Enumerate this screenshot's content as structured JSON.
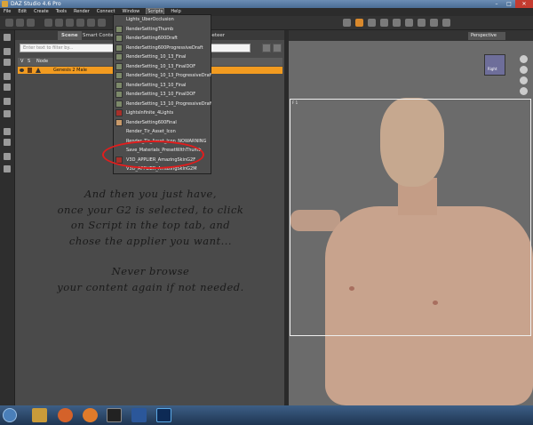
{
  "window": {
    "title": "DAZ Studio 4.6 Pro"
  },
  "menubar": [
    "File",
    "Edit",
    "Create",
    "Tools",
    "Render",
    "Connect",
    "Window",
    "Scripts",
    "Help"
  ],
  "active_menu": "Scripts",
  "panel": {
    "tabs": [
      "Scene",
      "Smart Content",
      "Poppeteer"
    ],
    "filter_placeholder": "Enter text to filter by...",
    "columns": [
      "V",
      "S",
      "Node"
    ],
    "rows": [
      {
        "name": "Genesis 2 Male"
      }
    ]
  },
  "scripts_menu": [
    {
      "label": "Lights_UberOcclusion",
      "icon": "none"
    },
    {
      "label": "RenderSettingThumb",
      "icon": "thumb"
    },
    {
      "label": "RenderSetting600Draft",
      "icon": "thumb"
    },
    {
      "label": "RenderSetting600ProgressiveDraft",
      "icon": "thumb"
    },
    {
      "label": "RenderSetting_10_13_Final",
      "icon": "thumb"
    },
    {
      "label": "RenderSetting_10_13_FinalDOF",
      "icon": "thumb"
    },
    {
      "label": "RenderSetting_10_13_ProgressiveDraft",
      "icon": "thumb"
    },
    {
      "label": "RenderSetting_13_10_Final",
      "icon": "thumb"
    },
    {
      "label": "RenderSetting_13_10_FinalDOF",
      "icon": "thumb"
    },
    {
      "label": "RenderSetting_13_10_ProgressiveDraft",
      "icon": "thumb"
    },
    {
      "label": "LightsInfinite_4Lights",
      "icon": "red"
    },
    {
      "label": "RenderSetting600Final",
      "icon": "tan"
    },
    {
      "label": "Render_Tir_Asset_Icon",
      "icon": "none"
    },
    {
      "label": "Render_Tir_Asset_Icon_NOWARNING",
      "icon": "none"
    },
    {
      "label": "Save_Materials_PresetWithThumb",
      "icon": "none"
    },
    {
      "label": "V3D_APPLIER_AmazingSkinG2F",
      "icon": "red"
    },
    {
      "label": "V3D_APPLIER_AmazingSkinG2M",
      "icon": "none"
    }
  ],
  "note": {
    "lines": [
      "And then you just have,",
      "once your G2 is selected, to click",
      "on Script in the top tab, and",
      "chose the applier you want...",
      "",
      "Never browse",
      "your content again if not needed."
    ]
  },
  "viewport": {
    "view_label": "Perspective View",
    "cube_label": "Right",
    "frame_label": "F 1"
  },
  "colors": {
    "selected_row": "#f29b20",
    "highlight_circle": "#e21d1d",
    "menubar_bg": "#2c2c2c"
  },
  "taskbar": [
    "start",
    "explorer",
    "firefox",
    "firefox-dev",
    "acrobat",
    "word",
    "photoshop"
  ]
}
